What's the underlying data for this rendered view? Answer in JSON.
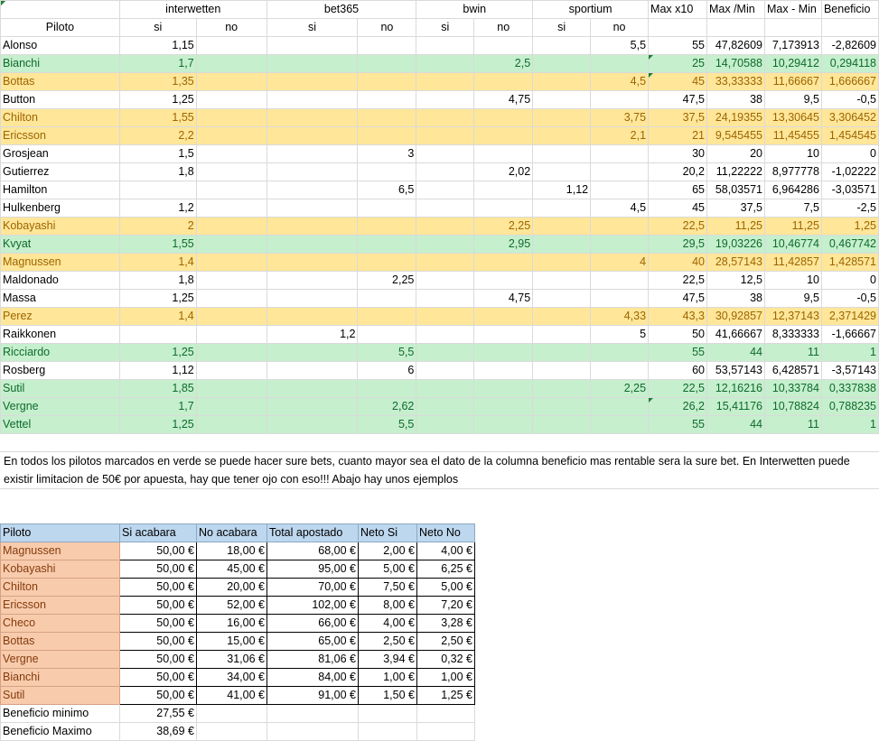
{
  "header": {
    "pilot": "Piloto",
    "bookmakers": [
      "interwetten",
      "bet365",
      "bwin",
      "sportium"
    ],
    "si": "si",
    "no": "no",
    "max_x10": "Max x10",
    "max_min": "Max /Min",
    "max_minus_min": "Max - Min",
    "beneficio": "Beneficio"
  },
  "rows": [
    {
      "name": "Alonso",
      "c": [
        "1,15",
        "",
        "",
        "",
        "",
        "",
        "",
        "5,5"
      ],
      "x10": "55",
      "mm": "47,82609",
      "mmin": "7,173913",
      "ben": "-2,82609",
      "style": "plain",
      "flag": false
    },
    {
      "name": "Bianchi",
      "c": [
        "1,7",
        "",
        "",
        "",
        "",
        "2,5",
        "",
        ""
      ],
      "x10": "25",
      "mm": "14,70588",
      "mmin": "10,29412",
      "ben": "0,294118",
      "style": "green",
      "flag": true
    },
    {
      "name": "Bottas",
      "c": [
        "1,35",
        "",
        "",
        "",
        "",
        "",
        "",
        "4,5"
      ],
      "x10": "45",
      "mm": "33,33333",
      "mmin": "11,66667",
      "ben": "1,666667",
      "style": "orange",
      "flag": true
    },
    {
      "name": "Button",
      "c": [
        "1,25",
        "",
        "",
        "",
        "",
        "4,75",
        "",
        ""
      ],
      "x10": "47,5",
      "mm": "38",
      "mmin": "9,5",
      "ben": "-0,5",
      "style": "plain",
      "flag": false
    },
    {
      "name": "Chilton",
      "c": [
        "1,55",
        "",
        "",
        "",
        "",
        "",
        "",
        "3,75"
      ],
      "x10": "37,5",
      "mm": "24,19355",
      "mmin": "13,30645",
      "ben": "3,306452",
      "style": "orange",
      "flag": false
    },
    {
      "name": "Ericsson",
      "c": [
        "2,2",
        "",
        "",
        "",
        "",
        "",
        "",
        "2,1"
      ],
      "x10": "21",
      "mm": "9,545455",
      "mmin": "11,45455",
      "ben": "1,454545",
      "style": "orange",
      "flag": false
    },
    {
      "name": "Grosjean",
      "c": [
        "1,5",
        "",
        "",
        "3",
        "",
        "",
        "",
        ""
      ],
      "x10": "30",
      "mm": "20",
      "mmin": "10",
      "ben": "0",
      "style": "plain",
      "flag": true
    },
    {
      "name": "Gutierrez",
      "c": [
        "1,8",
        "",
        "",
        "",
        "",
        "2,02",
        "",
        ""
      ],
      "x10": "20,2",
      "mm": "11,22222",
      "mmin": "8,977778",
      "ben": "-1,02222",
      "style": "plain",
      "flag": false
    },
    {
      "name": "Hamilton",
      "c": [
        "",
        "",
        "",
        "6,5",
        "",
        "",
        "1,12",
        ""
      ],
      "x10": "65",
      "mm": "58,03571",
      "mmin": "6,964286",
      "ben": "-3,03571",
      "style": "plain",
      "flag": true
    },
    {
      "name": "Hulkenberg",
      "c": [
        "1,2",
        "",
        "",
        "",
        "",
        "",
        "",
        "4,5"
      ],
      "x10": "45",
      "mm": "37,5",
      "mmin": "7,5",
      "ben": "-2,5",
      "style": "plain",
      "flag": false
    },
    {
      "name": "Kobayashi",
      "c": [
        "2",
        "",
        "",
        "",
        "",
        "2,25",
        "",
        ""
      ],
      "x10": "22,5",
      "mm": "11,25",
      "mmin": "11,25",
      "ben": "1,25",
      "style": "orange",
      "flag": false
    },
    {
      "name": "Kvyat",
      "c": [
        "1,55",
        "",
        "",
        "",
        "",
        "2,95",
        "",
        ""
      ],
      "x10": "29,5",
      "mm": "19,03226",
      "mmin": "10,46774",
      "ben": "0,467742",
      "style": "green",
      "flag": false
    },
    {
      "name": "Magnussen",
      "c": [
        "1,4",
        "",
        "",
        "",
        "",
        "",
        "",
        "4"
      ],
      "x10": "40",
      "mm": "28,57143",
      "mmin": "11,42857",
      "ben": "1,428571",
      "style": "orange",
      "flag": false
    },
    {
      "name": "Maldonado",
      "c": [
        "1,8",
        "",
        "",
        "2,25",
        "",
        "",
        "",
        ""
      ],
      "x10": "22,5",
      "mm": "12,5",
      "mmin": "10",
      "ben": "0",
      "style": "plain",
      "flag": false
    },
    {
      "name": "Massa",
      "c": [
        "1,25",
        "",
        "",
        "",
        "",
        "4,75",
        "",
        ""
      ],
      "x10": "47,5",
      "mm": "38",
      "mmin": "9,5",
      "ben": "-0,5",
      "style": "plain",
      "flag": false
    },
    {
      "name": "Perez",
      "c": [
        "1,4",
        "",
        "",
        "",
        "",
        "",
        "",
        "4,33"
      ],
      "x10": "43,3",
      "mm": "30,92857",
      "mmin": "12,37143",
      "ben": "2,371429",
      "style": "orange",
      "flag": false
    },
    {
      "name": "Raikkonen",
      "c": [
        "",
        "",
        "1,2",
        "",
        "",
        "",
        "",
        "5"
      ],
      "x10": "50",
      "mm": "41,66667",
      "mmin": "8,333333",
      "ben": "-1,66667",
      "style": "plain",
      "flag": false
    },
    {
      "name": "Ricciardo",
      "c": [
        "1,25",
        "",
        "",
        "5,5",
        "",
        "",
        "",
        ""
      ],
      "x10": "55",
      "mm": "44",
      "mmin": "11",
      "ben": "1",
      "style": "green",
      "flag": false
    },
    {
      "name": "Rosberg",
      "c": [
        "1,12",
        "",
        "",
        "6",
        "",
        "",
        "",
        ""
      ],
      "x10": "60",
      "mm": "53,57143",
      "mmin": "6,428571",
      "ben": "-3,57143",
      "style": "plain",
      "flag": false
    },
    {
      "name": "Sutil",
      "c": [
        "1,85",
        "",
        "",
        "",
        "",
        "",
        "",
        "2,25"
      ],
      "x10": "22,5",
      "mm": "12,16216",
      "mmin": "10,33784",
      "ben": "0,337838",
      "style": "green",
      "flag": false
    },
    {
      "name": "Vergne",
      "c": [
        "1,7",
        "",
        "",
        "2,62",
        "",
        "",
        "",
        ""
      ],
      "x10": "26,2",
      "mm": "15,41176",
      "mmin": "10,78824",
      "ben": "0,788235",
      "style": "green",
      "flag": true
    },
    {
      "name": "Vettel",
      "c": [
        "1,25",
        "",
        "",
        "5,5",
        "",
        "",
        "",
        ""
      ],
      "x10": "55",
      "mm": "44",
      "mmin": "11",
      "ben": "1",
      "style": "green",
      "flag": false
    }
  ],
  "note": "En todos los pilotos marcados en verde se puede hacer sure bets, cuanto mayor sea el dato de la columna beneficio mas rentable sera la sure bet. En Interwetten puede existir limitacion de 50€ por apuesta, hay que tener ojo con eso!!! Abajo hay unos ejemplos",
  "examples": {
    "headers": [
      "Piloto",
      "Si acabara",
      "No acabara",
      "Total apostado",
      "Neto Si",
      "Neto No"
    ],
    "rows": [
      [
        "Magnussen",
        "50,00 €",
        "18,00 €",
        "68,00 €",
        "2,00 €",
        "4,00 €"
      ],
      [
        "Kobayashi",
        "50,00 €",
        "45,00 €",
        "95,00 €",
        "5,00 €",
        "6,25 €"
      ],
      [
        "Chilton",
        "50,00 €",
        "20,00 €",
        "70,00 €",
        "7,50 €",
        "5,00 €"
      ],
      [
        "Ericsson",
        "50,00 €",
        "52,00 €",
        "102,00 €",
        "8,00 €",
        "7,20 €"
      ],
      [
        "Checo",
        "50,00 €",
        "16,00 €",
        "66,00 €",
        "4,00 €",
        "3,28 €"
      ],
      [
        "Bottas",
        "50,00 €",
        "15,00 €",
        "65,00 €",
        "2,50 €",
        "2,50 €"
      ],
      [
        "Vergne",
        "50,00 €",
        "31,06 €",
        "81,06 €",
        "3,94 €",
        "0,32 €"
      ],
      [
        "Bianchi",
        "50,00 €",
        "34,00 €",
        "84,00 €",
        "1,00 €",
        "1,00 €"
      ],
      [
        "Sutil",
        "50,00 €",
        "41,00 €",
        "91,00 €",
        "1,50 €",
        "1,25 €"
      ]
    ],
    "beneficio_minimo_label": "Beneficio minimo",
    "beneficio_minimo": "27,55 €",
    "beneficio_maximo_label": "Beneficio Maximo",
    "beneficio_maximo": "38,69 €"
  }
}
